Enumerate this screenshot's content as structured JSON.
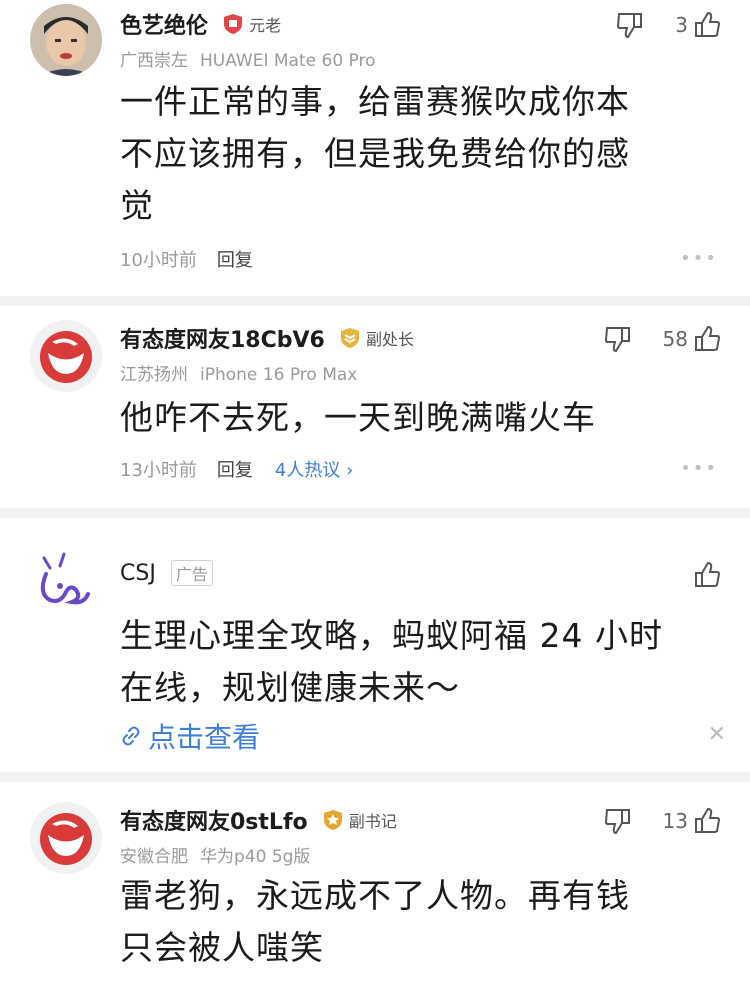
{
  "comments": [
    {
      "name": "色艺绝伦",
      "badge": "元老",
      "location": "广西崇左",
      "device": "HUAWEI Mate 60 Pro",
      "text_lines": [
        "一件正常的事，给雷赛猴吹成你本",
        "不应该拥有，但是我免费给你的感",
        "觉"
      ],
      "time": "10小时前",
      "reply": "回复",
      "likes": "3"
    },
    {
      "name": "有态度网友18CbV6",
      "badge": "副处长",
      "location": "江苏扬州",
      "device": "iPhone 16 Pro Max",
      "text_lines": [
        "他咋不去死，一天到晚满嘴火车"
      ],
      "time": "13小时前",
      "reply": "回复",
      "hot_replies": "4人热议 ›",
      "likes": "58"
    },
    {
      "name": "有态度网友0stLfo",
      "badge": "副书记",
      "location": "安徽合肥",
      "device": "华为p40 5g版",
      "text_lines": [
        "雷老狗，永远成不了人物。再有钱",
        "只会被人嗤笑"
      ],
      "likes": "13"
    }
  ],
  "ad": {
    "name": "CSJ",
    "tag": "广告",
    "text_lines": [
      "生理心理全攻略，蚂蚁阿福 24 小时",
      "在线，规划健康未来～"
    ],
    "link": "点击查看"
  },
  "colors": {
    "link": "#3f7fd6",
    "divider": "#f2f2f2",
    "meta": "#9a9a9a"
  }
}
